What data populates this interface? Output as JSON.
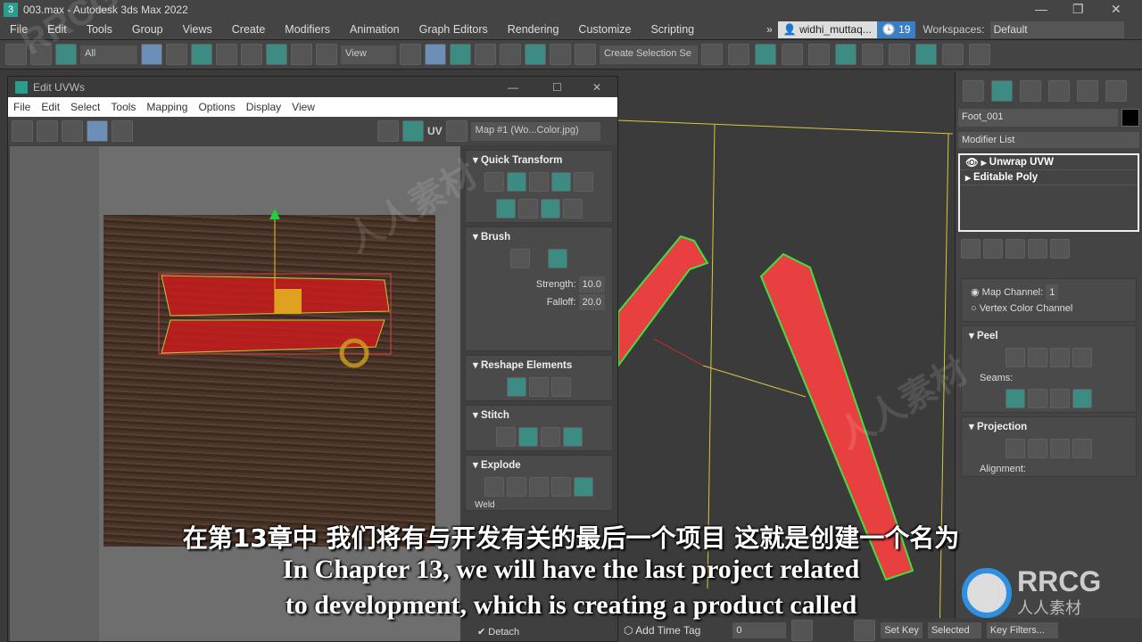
{
  "app": {
    "title": "003.max - Autodesk 3ds Max 2022",
    "logo": "3"
  },
  "menu": [
    "File",
    "Edit",
    "Tools",
    "Group",
    "Views",
    "Create",
    "Modifiers",
    "Animation",
    "Graph Editors",
    "Rendering",
    "Customize",
    "Scripting"
  ],
  "account": {
    "overflow": "»",
    "user": "widhi_muttaq...",
    "clock_count": "19",
    "workspaces_label": "Workspaces:",
    "workspace": "Default"
  },
  "toolbar": {
    "filter": "All",
    "ref_coord": "View",
    "selection_set": "Create Selection Se",
    "icons_a": [
      "link-icon",
      "unlink-icon",
      "bind-space-warp-icon"
    ],
    "icons_b": [
      "select-object-icon",
      "select-by-name-icon",
      "rectangular-selection-icon",
      "window-crossing-icon",
      "move-icon",
      "rotate-icon",
      "scale-icon",
      "placement-icon"
    ],
    "icons_c": [
      "pivot-icon",
      "select-manipulate-icon",
      "keyboard-shortcut-icon",
      "snap-toggle-icon",
      "angle-snap-icon",
      "percent-snap-icon",
      "spinner-snap-icon",
      "edit-named-selection-icon"
    ],
    "icons_d": [
      "mirror-icon",
      "align-icon",
      "scene-explorer-icon",
      "layer-explorer-icon",
      "toolbox-icon",
      "curve-editor-icon",
      "schematic-view-icon",
      "material-editor-icon",
      "render-setup-icon",
      "rendered-frame-icon",
      "render-icon"
    ]
  },
  "uvw": {
    "title": "Edit UVWs",
    "menu": [
      "File",
      "Edit",
      "Select",
      "Tools",
      "Mapping",
      "Options",
      "Display",
      "View"
    ],
    "tools": [
      "move-icon",
      "rotate-icon",
      "scale-icon",
      "freeform-icon",
      "mirror-icon"
    ],
    "right_tools": [
      "checker-icon",
      "texture-icon"
    ],
    "uv_label": "UV",
    "map": "Map #1 (Wo...Color.jpg)",
    "rollouts": {
      "quick_transform": "Quick Transform",
      "brush": "Brush",
      "strength_label": "Strength:",
      "strength": "10.0",
      "falloff_label": "Falloff:",
      "falloff": "20.0",
      "reshape": "Reshape Elements",
      "stitch": "Stitch",
      "explode": "Explode",
      "weld": "Weld",
      "detach": "Detach"
    }
  },
  "cmd": {
    "tabs": [
      "create-icon",
      "modify-icon",
      "hierarchy-icon",
      "motion-icon",
      "display-icon",
      "utilities-icon"
    ],
    "object_name": "Foot_001",
    "object_color": "#000000",
    "modifier_list": "Modifier List",
    "stack": [
      "Unwrap UVW",
      "Editable Poly"
    ],
    "map_channel_label": "Map Channel:",
    "map_channel": "1",
    "vertex_color": "Vertex Color Channel",
    "peel": "Peel",
    "seams": "Seams:",
    "projection": "Projection",
    "alignment": "Alignment:"
  },
  "bottom": {
    "add_time_tag": "Add Time Tag",
    "frame": "0",
    "set_key": "Set Key",
    "selected": "Selected",
    "key_filters": "Key Filters..."
  },
  "subtitles": {
    "zh": "在第13章中 我们将有与开发有关的最后一个项目 这就是创建一个名为",
    "en1": "In Chapter 13, we will have the last project related",
    "en2": "to development, which is creating a product called"
  },
  "watermark": {
    "brand": "RRCG",
    "sub": "人人素材"
  },
  "colors": {
    "accent": "#3d8c84",
    "uv_selection": "#e02020",
    "gizmo": "#f0c020"
  }
}
